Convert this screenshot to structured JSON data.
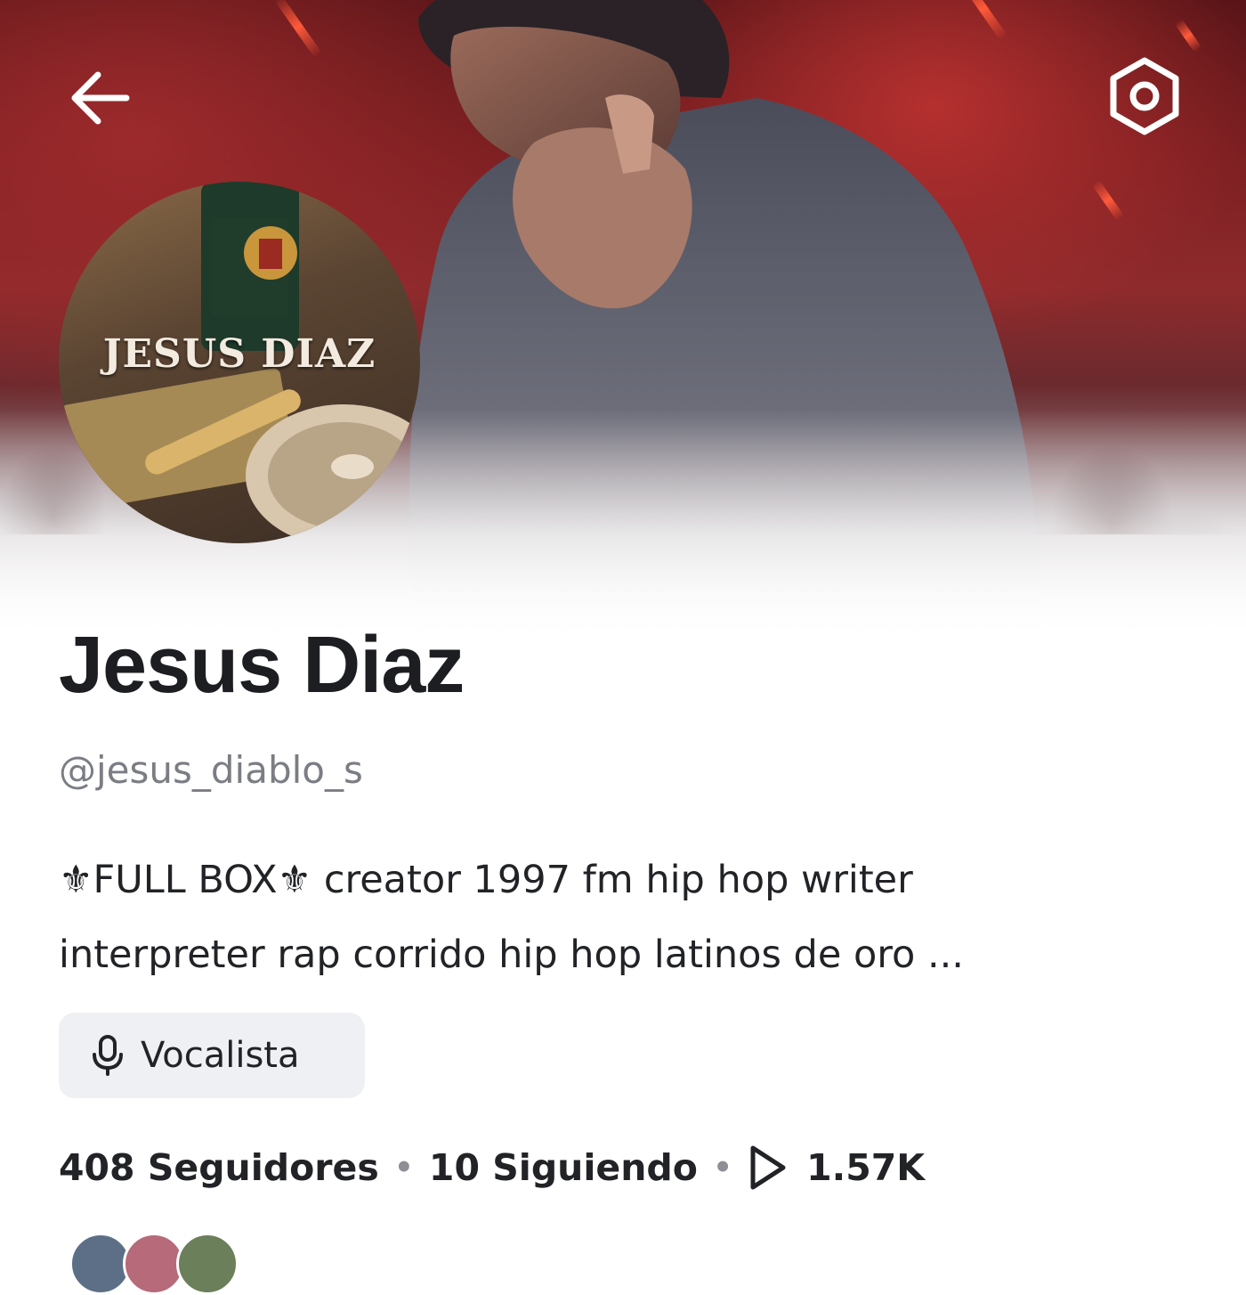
{
  "header": {
    "back_icon": "arrow-left-icon",
    "settings_icon": "gear-icon",
    "avatar_text": "JESUS DIAZ"
  },
  "profile": {
    "display_name": "Jesus Diaz",
    "username": "@jesus_diablo_s",
    "bio_line_1": "⚜FULL BOX⚜ creator 1997 fm hip hop writer",
    "bio_line_2": "interpreter rap corrido hip hop latinos de oro ...",
    "role": {
      "icon": "microphone-icon",
      "label": "Vocalista"
    }
  },
  "stats": {
    "followers": "408 Seguidores",
    "following": "10 Siguiendo",
    "separator": "•",
    "plays_icon": "play-icon",
    "plays": "1.57K"
  },
  "colors": {
    "text_primary": "#1d1e22",
    "text_secondary": "#7b7d84",
    "chip_bg": "#eef0f3",
    "hero_red": "#8e2a2c"
  }
}
